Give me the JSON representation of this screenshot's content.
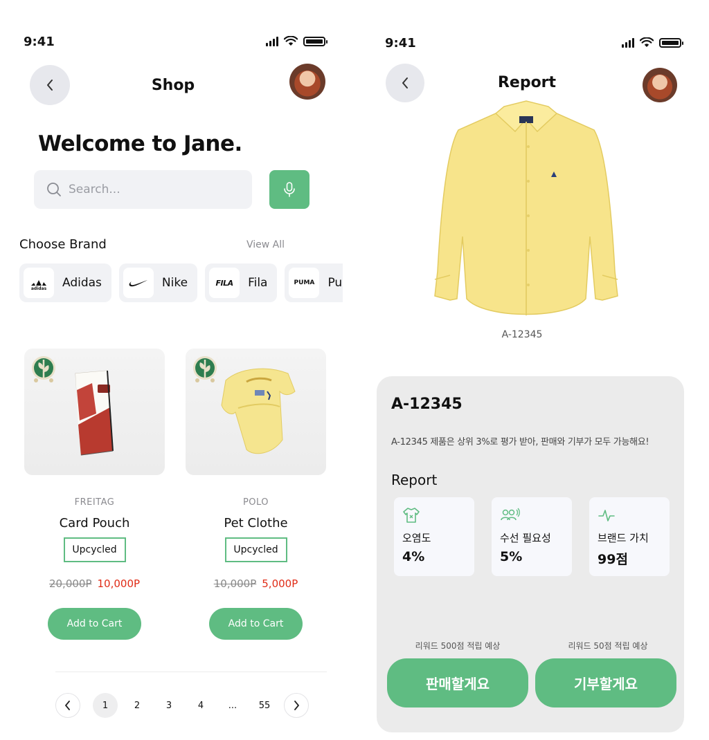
{
  "status": {
    "time": "9:41"
  },
  "shop": {
    "title": "Shop",
    "welcome": "Welcome to Jane.",
    "search": {
      "placeholder": "Search..."
    },
    "brands_heading": "Choose Brand",
    "view_all": "View All",
    "brands": [
      {
        "name": "Adidas",
        "logo": "adidas"
      },
      {
        "name": "Nike",
        "logo": "nike-swoosh"
      },
      {
        "name": "Fila",
        "logo": "FILA"
      },
      {
        "name": "Pu",
        "logo": "PUMA"
      }
    ],
    "products": [
      {
        "brand": "FREITAG",
        "name": "Card Pouch",
        "tag": "Upcycled",
        "old_price": "20,000P",
        "new_price": "10,000P",
        "cta": "Add to Cart"
      },
      {
        "brand": "POLO",
        "name": "Pet Clothe",
        "tag": "Upcycled",
        "old_price": "10,000P",
        "new_price": "5,000P",
        "cta": "Add to Cart"
      }
    ],
    "pagination": [
      "1",
      "2",
      "3",
      "4",
      "...",
      "55"
    ],
    "current_page": "1"
  },
  "report": {
    "title": "Report",
    "image_caption": "A-12345",
    "card": {
      "title": "A-12345",
      "description": "A-12345 제품은 상위 3%로 평가 받아, 판매와 기부가 모두 가능해요!",
      "subtitle": "Report",
      "stats": [
        {
          "label": "오염도",
          "value": "4%",
          "icon": "shirt-icon"
        },
        {
          "label": "수선 필요성",
          "value": "5%",
          "icon": "people-icon"
        },
        {
          "label": "브랜드 가치",
          "value": "99점",
          "icon": "pulse-icon"
        }
      ],
      "sell": {
        "reward": "리워드 500점 적립 예상",
        "label": "판매할게요"
      },
      "donate": {
        "reward": "리워드 50점 적립 예상",
        "label": "기부할게요"
      }
    }
  },
  "colors": {
    "accent": "#5fbc82",
    "sale": "#e02b16",
    "card_bg": "#ebebeb"
  }
}
